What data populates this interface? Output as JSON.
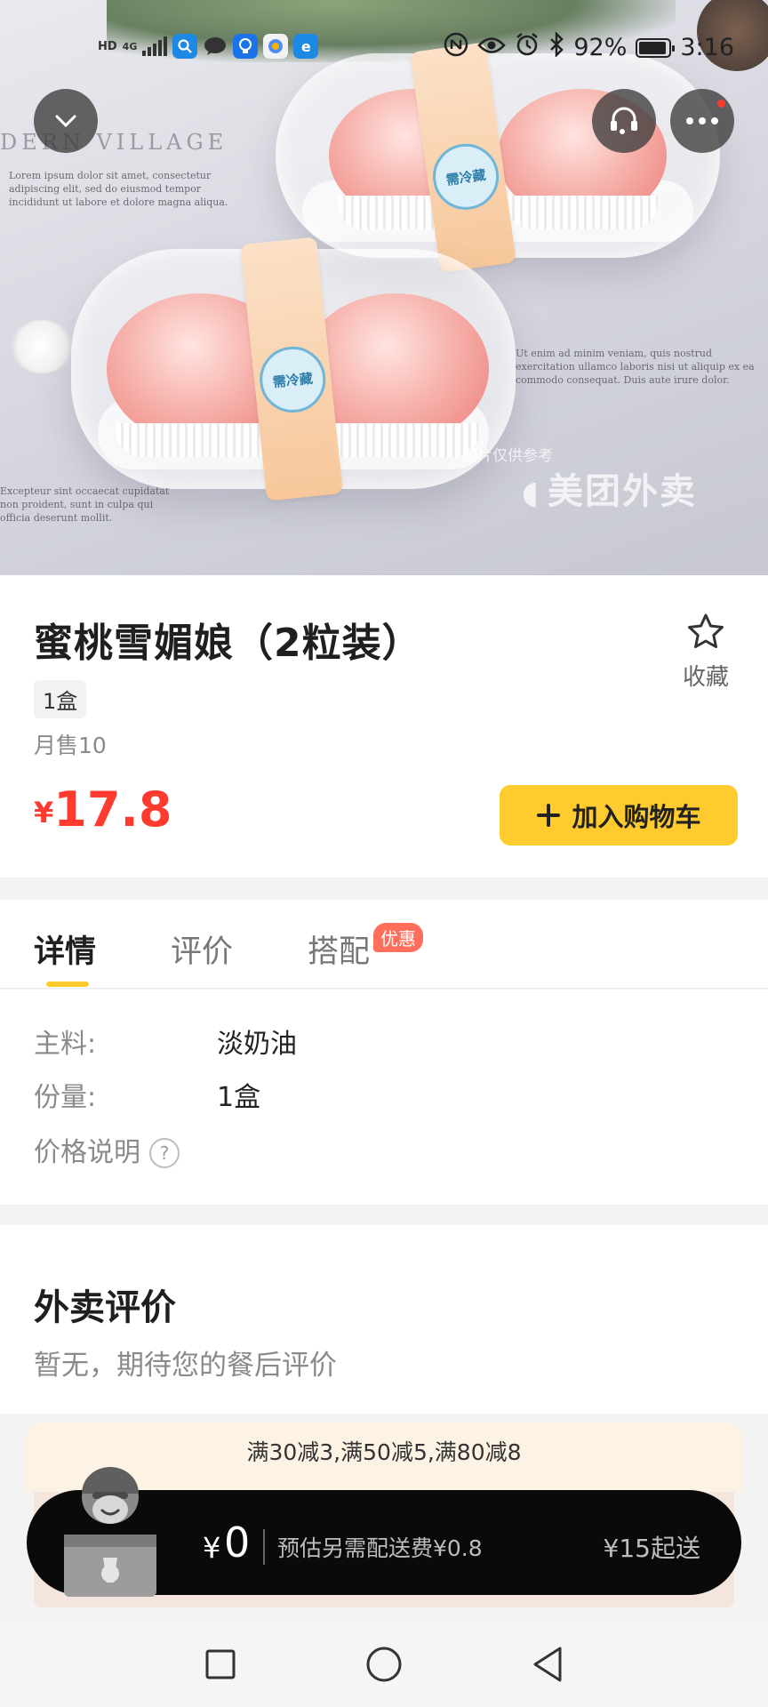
{
  "status_bar": {
    "signal_label": "HD",
    "network": "4G",
    "battery": "92%",
    "time": "3:16"
  },
  "hero": {
    "backdrop_text": "DERN VILLAGE",
    "seal_text": "需冷藏",
    "watermark": "美团外卖",
    "watermark_note": "图片仅供参考"
  },
  "header_buttons": {
    "collapse_icon": "chevron-down-icon",
    "service_icon": "customer-service-icon",
    "more_icon": "more-icon"
  },
  "product": {
    "title": "蜜桃雪媚娘（2粒装）",
    "spec_chip": "1盒",
    "monthly_sales": "月售10",
    "currency": "¥",
    "price": "17.8",
    "favorite_label": "收藏",
    "add_cart_label": "加入购物车"
  },
  "tabs": [
    {
      "label": "详情",
      "active": true
    },
    {
      "label": "评价",
      "active": false
    },
    {
      "label": "搭配",
      "active": false,
      "badge": "优惠"
    }
  ],
  "details": {
    "rows": [
      {
        "key": "主料:",
        "value": "淡奶油"
      },
      {
        "key": "份量:",
        "value": "1盒"
      }
    ],
    "price_note_label": "价格说明",
    "price_note_icon": "?"
  },
  "reviews": {
    "title": "外卖评价",
    "empty_text": "暂无，期待您的餐后评价"
  },
  "promo": {
    "text": "满30减3,满50减5,满80减8"
  },
  "cart_bar": {
    "currency": "¥",
    "total": "0",
    "delivery_fee_text": "预估另需配送费¥0.8",
    "min_order_text": "¥15起送"
  },
  "colors": {
    "accent": "#ffcb2f",
    "price": "#ff3b2f",
    "promo_badge": "#ff6f5c"
  }
}
